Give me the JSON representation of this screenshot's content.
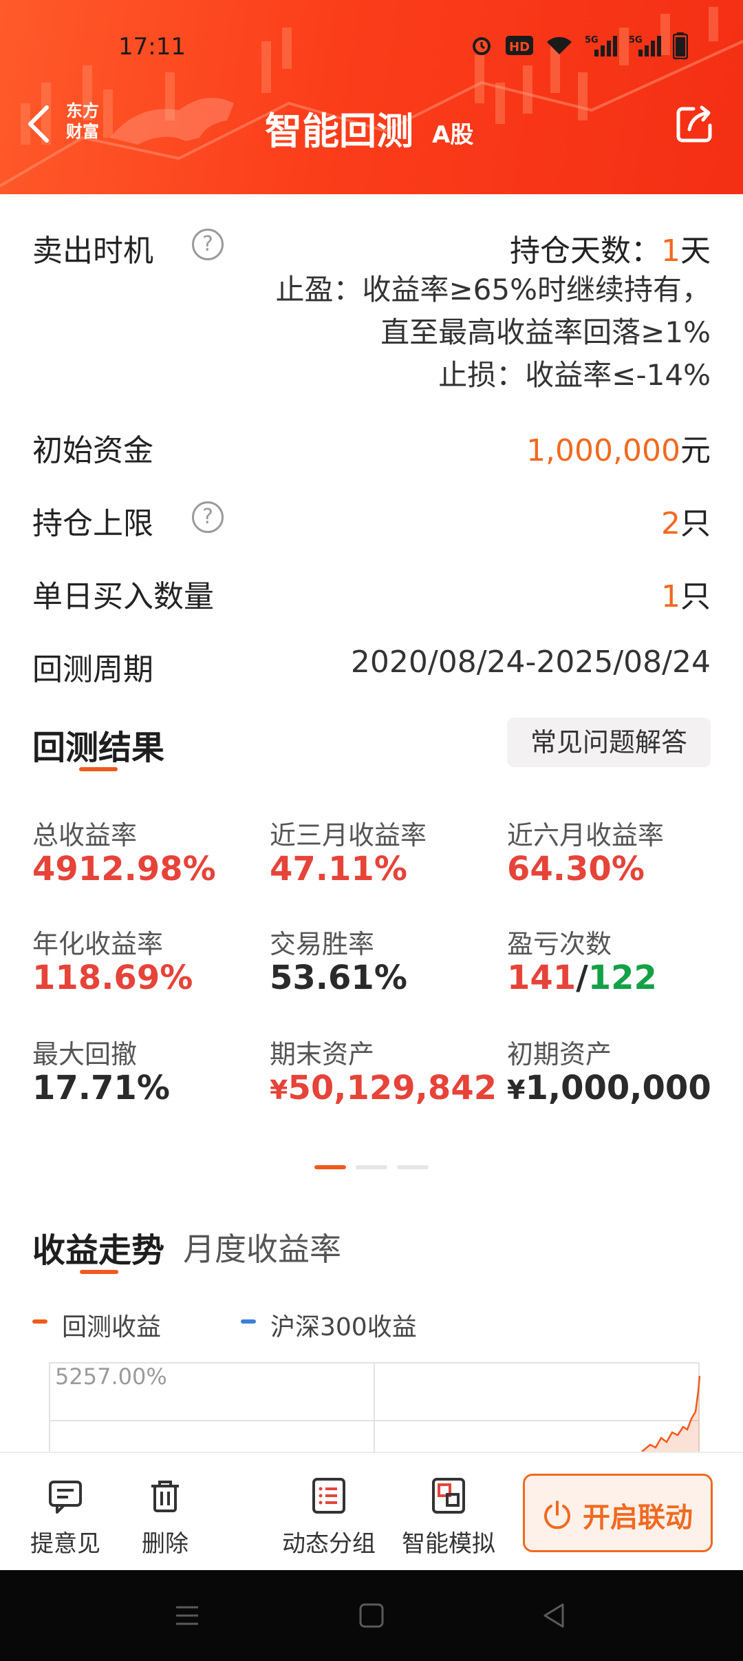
{
  "status_bar": {
    "time": "17:11",
    "hd_badge": "HD",
    "network_1": "5G",
    "network_2": "5G"
  },
  "header": {
    "brand": "东方财富",
    "brand_line1": "东方",
    "brand_line2": "财富",
    "title": "智能回测",
    "title_sub": "A股"
  },
  "settings": {
    "sell_timing_label": "卖出时机",
    "holding_days_label": "持仓天数：",
    "holding_days_value": "1",
    "holding_days_unit": "天",
    "take_profit_line1": "止盈：收益率≥65%时继续持有，",
    "take_profit_line2": "直至最高收益率回落≥1%",
    "stop_loss_line": "止损：收益率≤-14%",
    "initial_capital_label": "初始资金",
    "initial_capital_value": "1,000,000",
    "initial_capital_unit": "元",
    "position_limit_label": "持仓上限",
    "position_limit_value": "2",
    "position_limit_unit": "只",
    "daily_buy_label": "单日买入数量",
    "daily_buy_value": "1",
    "daily_buy_unit": "只",
    "period_label": "回测周期",
    "period_value": "2020/08/24-2025/08/24"
  },
  "results": {
    "title": "回测结果",
    "faq_button": "常见问题解答",
    "metrics": [
      {
        "label": "总收益率",
        "value": "4912.98%"
      },
      {
        "label": "近三月收益率",
        "value": "47.11%"
      },
      {
        "label": "近六月收益率",
        "value": "64.30%"
      },
      {
        "label": "年化收益率",
        "value": "118.69%"
      },
      {
        "label": "交易胜率",
        "value": "53.61%"
      },
      {
        "label": "盈亏次数",
        "value_win": "141",
        "value_sep": "/",
        "value_loss": "122"
      },
      {
        "label": "最大回撤",
        "value": "17.71%"
      },
      {
        "label": "期末资产",
        "currency": "¥",
        "value": "50,129,842"
      },
      {
        "label": "初期资产",
        "currency": "¥",
        "value": "1,000,000"
      }
    ],
    "pager_total": 3,
    "pager_active": 1
  },
  "trend": {
    "tab_active": "收益走势",
    "tab_inactive": "月度收益率",
    "legend": [
      {
        "name": "回测收益",
        "color": "#f05a1e"
      },
      {
        "name": "沪深300收益",
        "color": "#3d7fd6"
      }
    ],
    "y_max_label": "5257.00%"
  },
  "chart_data": {
    "type": "line",
    "title": "",
    "series": [
      {
        "name": "回测收益",
        "color": "#f05a1e"
      },
      {
        "name": "沪深300收益",
        "color": "#3d7fd6"
      }
    ],
    "ylim_top_label": "5257.00%",
    "grid": true
  },
  "toolbar": {
    "feedback": "提意见",
    "delete": "删除",
    "dynamic_group": "动态分组",
    "smart_sim": "智能模拟",
    "link_button": "开启联动"
  },
  "colors": {
    "header_bg": "#f83c18",
    "accent_orange": "#f06a20",
    "profit_red": "#e64339",
    "loss_green": "#14a047"
  }
}
